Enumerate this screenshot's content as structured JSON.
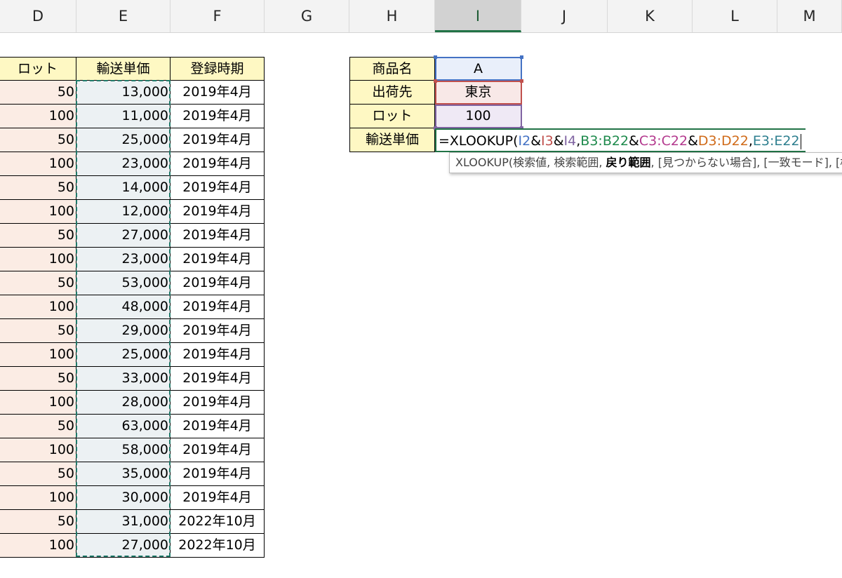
{
  "columns": [
    {
      "letter": "D",
      "selected": false
    },
    {
      "letter": "E",
      "selected": false
    },
    {
      "letter": "F",
      "selected": false
    },
    {
      "letter": "G",
      "selected": false
    },
    {
      "letter": "H",
      "selected": false
    },
    {
      "letter": "I",
      "selected": true
    },
    {
      "letter": "J",
      "selected": false
    },
    {
      "letter": "K",
      "selected": false
    },
    {
      "letter": "L",
      "selected": false
    },
    {
      "letter": "M",
      "selected": false
    }
  ],
  "table": {
    "headers": {
      "lot": "ロット",
      "unit_price": "輸送単価",
      "registered": "登録時期"
    },
    "rows": [
      {
        "lot": "50",
        "price": "13,000",
        "date": "2019年4月"
      },
      {
        "lot": "100",
        "price": "11,000",
        "date": "2019年4月"
      },
      {
        "lot": "50",
        "price": "25,000",
        "date": "2019年4月"
      },
      {
        "lot": "100",
        "price": "23,000",
        "date": "2019年4月"
      },
      {
        "lot": "50",
        "price": "14,000",
        "date": "2019年4月"
      },
      {
        "lot": "100",
        "price": "12,000",
        "date": "2019年4月"
      },
      {
        "lot": "50",
        "price": "27,000",
        "date": "2019年4月"
      },
      {
        "lot": "100",
        "price": "23,000",
        "date": "2019年4月"
      },
      {
        "lot": "50",
        "price": "53,000",
        "date": "2019年4月"
      },
      {
        "lot": "100",
        "price": "48,000",
        "date": "2019年4月"
      },
      {
        "lot": "50",
        "price": "29,000",
        "date": "2019年4月"
      },
      {
        "lot": "100",
        "price": "25,000",
        "date": "2019年4月"
      },
      {
        "lot": "50",
        "price": "33,000",
        "date": "2019年4月"
      },
      {
        "lot": "100",
        "price": "28,000",
        "date": "2019年4月"
      },
      {
        "lot": "50",
        "price": "63,000",
        "date": "2019年4月"
      },
      {
        "lot": "100",
        "price": "58,000",
        "date": "2019年4月"
      },
      {
        "lot": "50",
        "price": "35,000",
        "date": "2019年4月"
      },
      {
        "lot": "100",
        "price": "30,000",
        "date": "2019年4月"
      },
      {
        "lot": "50",
        "price": "31,000",
        "date": "2022年10月"
      },
      {
        "lot": "100",
        "price": "27,000",
        "date": "2022年10月"
      }
    ]
  },
  "lookup": {
    "product_label": "商品名",
    "product_value": "A",
    "dest_label": "出荷先",
    "dest_value": "東京",
    "lot_label": "ロット",
    "lot_value": "100",
    "price_label": "輸送単価"
  },
  "formula": {
    "prefix": "=XLOOKUP(",
    "segments": [
      {
        "text": "I2",
        "color": "#4472c4"
      },
      {
        "text": "&",
        "color": "#000000"
      },
      {
        "text": "I3",
        "color": "#c0504d"
      },
      {
        "text": "&",
        "color": "#000000"
      },
      {
        "text": "I4",
        "color": "#8064a2"
      },
      {
        "text": ",",
        "color": "#000000"
      },
      {
        "text": "B3:B22",
        "color": "#1e8a4c"
      },
      {
        "text": "&",
        "color": "#000000"
      },
      {
        "text": "C3:C22",
        "color": "#b4398e"
      },
      {
        "text": "&",
        "color": "#000000"
      },
      {
        "text": "D3:D22",
        "color": "#d06b1a"
      },
      {
        "text": ",",
        "color": "#000000"
      },
      {
        "text": "E3:E22",
        "color": "#2e7f8f"
      }
    ]
  },
  "tooltip": {
    "func": "XLOOKUP(",
    "arg1": "検索値, ",
    "arg2": "検索範囲, ",
    "arg3_bold": "戻り範囲",
    "rest": ", [見つからない場合], [一致モード], [検索モード])"
  },
  "colors": {
    "header_fill": "#fef8c3",
    "d_column_fill": "#fbece4",
    "e_column_fill": "#ecf1f3",
    "ref_I2": "#4472c4",
    "ref_I3": "#c0504d",
    "ref_I4": "#8064a2",
    "marquee": "#1f7a6a"
  }
}
